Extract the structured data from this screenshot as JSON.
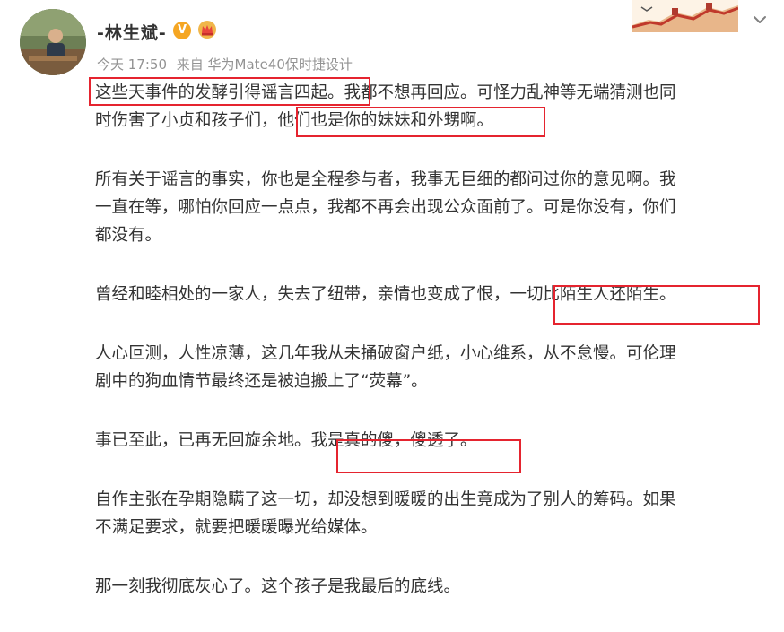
{
  "post": {
    "username": "-林生斌-",
    "verified_badge": "V",
    "time": "今天 17:50",
    "source": "来自 华为Mate40保时捷设计"
  },
  "icons": {
    "verified": "verified-v-badge-icon",
    "crown": "vip-crown-icon",
    "banner": "great-wall-banner-icon",
    "menu": "chevron-down-icon"
  },
  "colors": {
    "highlight": "#e5242f",
    "text": "#333333",
    "meta": "#939393",
    "badge": "#f5a623"
  },
  "paragraphs": [
    [
      "这些天事件的发酵引得谣言四起。我都不想再回应。可怪力乱神等无端猜测也同",
      "时伤害了小贞和孩子们，他们也是你的妹妹和外甥啊。"
    ],
    [
      "所有关于谣言的事实，你也是全程参与者，我事无巨细的都问过你的意见啊。我",
      "一直在等，哪怕你回应一点点，我都不再会出现公众面前了。可是你没有，你们",
      "都没有。"
    ],
    [
      "曾经和睦相处的一家人，失去了纽带，亲情也变成了恨，一切比陌生人还陌生。"
    ],
    [
      "人心叵测，人性凉薄，这几年我从未捅破窗户纸，小心维系，从不怠慢。可伦理",
      "剧中的狗血情节最终还是被迫搬上了“荧幕”。"
    ],
    [
      "事已至此，已再无回旋余地。我是真的傻，傻透了。"
    ],
    [
      "自作主张在孕期隐瞒了这一切，却没想到暖暖的出生竟成为了别人的筹码。如果",
      "不满足要求，就要把暖暖曝光给媒体。"
    ],
    [
      "那一刻我彻底灰心了。这个孩子是我最后的底线。"
    ]
  ]
}
